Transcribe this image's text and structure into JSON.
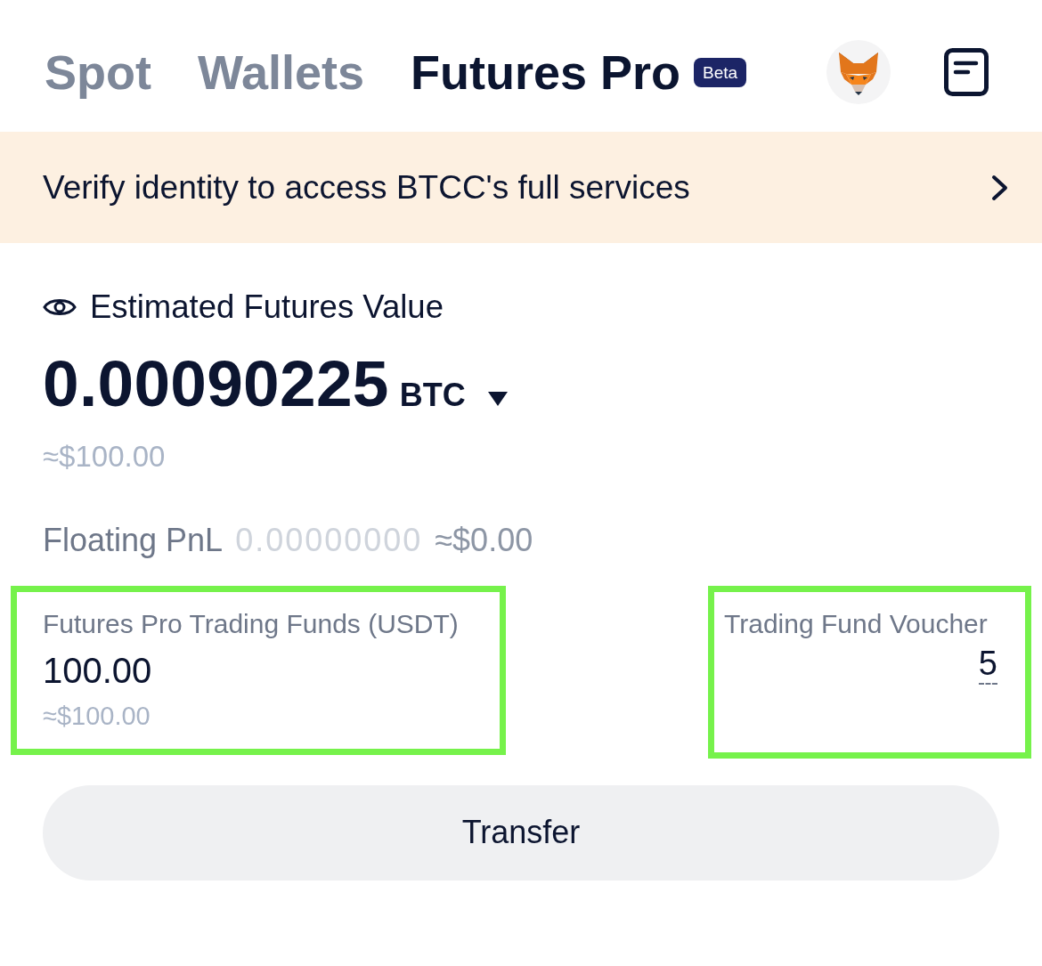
{
  "tabs": [
    {
      "label": "Spot",
      "selected": false
    },
    {
      "label": "Wallets",
      "selected": false
    },
    {
      "label": "Futures Pro",
      "selected": true,
      "badge": "Beta"
    }
  ],
  "banner": {
    "text": "Verify identity to access BTCC's full services"
  },
  "estimate": {
    "label": "Estimated Futures Value",
    "value": "0.00090225",
    "unit": "BTC",
    "usd": "≈$100.00"
  },
  "floating_pnl": {
    "label": "Floating PnL",
    "value": "0.00000000",
    "usd": "≈$0.00"
  },
  "funds": [
    {
      "kind": "amount",
      "label": "Futures Pro Trading Funds (USDT)",
      "value": "100.00",
      "usd": "≈$100.00",
      "highlighted": true
    },
    {
      "kind": "voucher",
      "label": "Trading Fund Voucher",
      "value": "5",
      "highlighted": true
    }
  ],
  "transfer_button": {
    "label": "Transfer"
  }
}
